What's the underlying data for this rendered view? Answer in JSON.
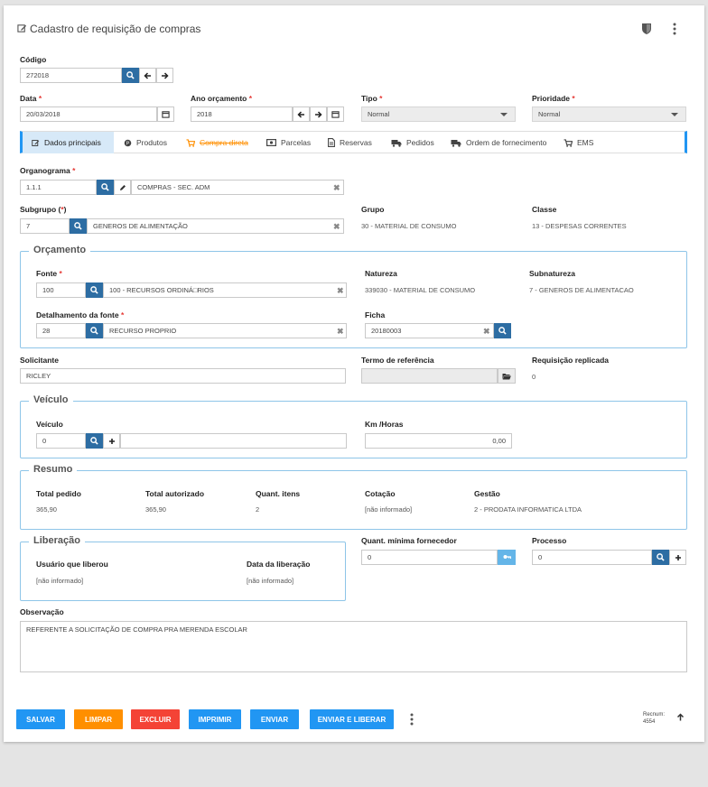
{
  "header": {
    "title": "Cadastro de requisição de compras"
  },
  "codigo": {
    "label": "Código",
    "value": "272018"
  },
  "data": {
    "label": "Data",
    "value": "20/03/2018"
  },
  "ano_orcamento": {
    "label": "Ano orçamento",
    "value": "2018"
  },
  "tipo": {
    "label": "Tipo",
    "value": "Normal"
  },
  "prioridade": {
    "label": "Prioridade",
    "value": "Normal"
  },
  "req_mark": "*",
  "tabs": [
    {
      "label": "Dados principais",
      "icon": "edit-icon"
    },
    {
      "label": "Produtos",
      "icon": "product-icon"
    },
    {
      "label": "Compra direta",
      "icon": "cart-icon"
    },
    {
      "label": "Parcelas",
      "icon": "money-icon"
    },
    {
      "label": "Reservas",
      "icon": "document-icon"
    },
    {
      "label": "Pedidos",
      "icon": "truck-icon"
    },
    {
      "label": "Ordem de fornecimento",
      "icon": "truck-icon"
    },
    {
      "label": "EMS",
      "icon": "cart-icon"
    }
  ],
  "organograma": {
    "label": "Organograma",
    "code": "1.1.1",
    "desc": "COMPRAS - SEC. ADM"
  },
  "subgrupo": {
    "label": "Subgrupo (",
    "label_end": ")",
    "code": "7",
    "desc": "GENEROS DE ALIMENTAÇÃO"
  },
  "grupo": {
    "label": "Grupo",
    "value": "30 - MATERIAL DE CONSUMO"
  },
  "classe": {
    "label": "Classe",
    "value": "13 - DESPESAS CORRENTES"
  },
  "orcamento": {
    "legend": "Orçamento",
    "fonte": {
      "label": "Fonte",
      "code": "100",
      "desc": "100 - RECURSOS ORDINÁ□RIOS"
    },
    "natureza": {
      "label": "Natureza",
      "value": "339030 - MATERIAL DE CONSUMO"
    },
    "subnatureza": {
      "label": "Subnatureza",
      "value": "7 - GENEROS DE ALIMENTACAO"
    },
    "detalhamento": {
      "label": "Detalhamento da fonte",
      "code": "28",
      "desc": "RECURSO PROPRIO"
    },
    "ficha": {
      "label": "Ficha",
      "value": "20180003"
    }
  },
  "solicitante": {
    "label": "Solicitante",
    "value": "RICLEY"
  },
  "termo": {
    "label": "Termo de referência",
    "value": ""
  },
  "replicada": {
    "label": "Requisição replicada",
    "value": "0"
  },
  "veiculo": {
    "legend": "Veículo",
    "label": "Veículo",
    "value": "0",
    "km_label": "Km /Horas",
    "km_value": "0,00"
  },
  "resumo": {
    "legend": "Resumo",
    "total_pedido": {
      "label": "Total pedido",
      "value": "365,90"
    },
    "total_autorizado": {
      "label": "Total autorizado",
      "value": "365,90"
    },
    "quant_itens": {
      "label": "Quant. itens",
      "value": "2"
    },
    "cotacao": {
      "label": "Cotação",
      "value": "[não informado]"
    },
    "gestao": {
      "label": "Gestão",
      "value": "2 - PRODATA INFORMATICA LTDA"
    }
  },
  "liberacao": {
    "legend": "Liberação",
    "usuario": {
      "label": "Usuário que liberou",
      "value": "[não informado]"
    },
    "data": {
      "label": "Data da liberação",
      "value": "[não informado]"
    }
  },
  "quant_minima": {
    "label": "Quant. mínima fornecedor",
    "value": "0"
  },
  "processo": {
    "label": "Processo",
    "value": "0"
  },
  "observacao": {
    "label": "Observação",
    "value": "REFERENTE A SOLICITAÇÃO DE COMPRA PRA MERENDA ESCOLAR"
  },
  "actions": {
    "salvar": "SALVAR",
    "limpar": "LIMPAR",
    "excluir": "EXCLUIR",
    "imprimir": "IMPRIMIR",
    "enviar": "ENVIAR",
    "enviar_liberar": "ENVIAR E LIBERAR"
  },
  "recnum": {
    "label": "Recnum:",
    "value": "4554"
  },
  "colors": {
    "primary": "#2196f3",
    "dark_blue": "#2d6da3",
    "orange": "#ff9800",
    "red": "#f44336",
    "accent_tab": "#ff8f00",
    "fieldset_border": "#8ec5e8",
    "active_tab_bg": "#d7e9f8"
  }
}
